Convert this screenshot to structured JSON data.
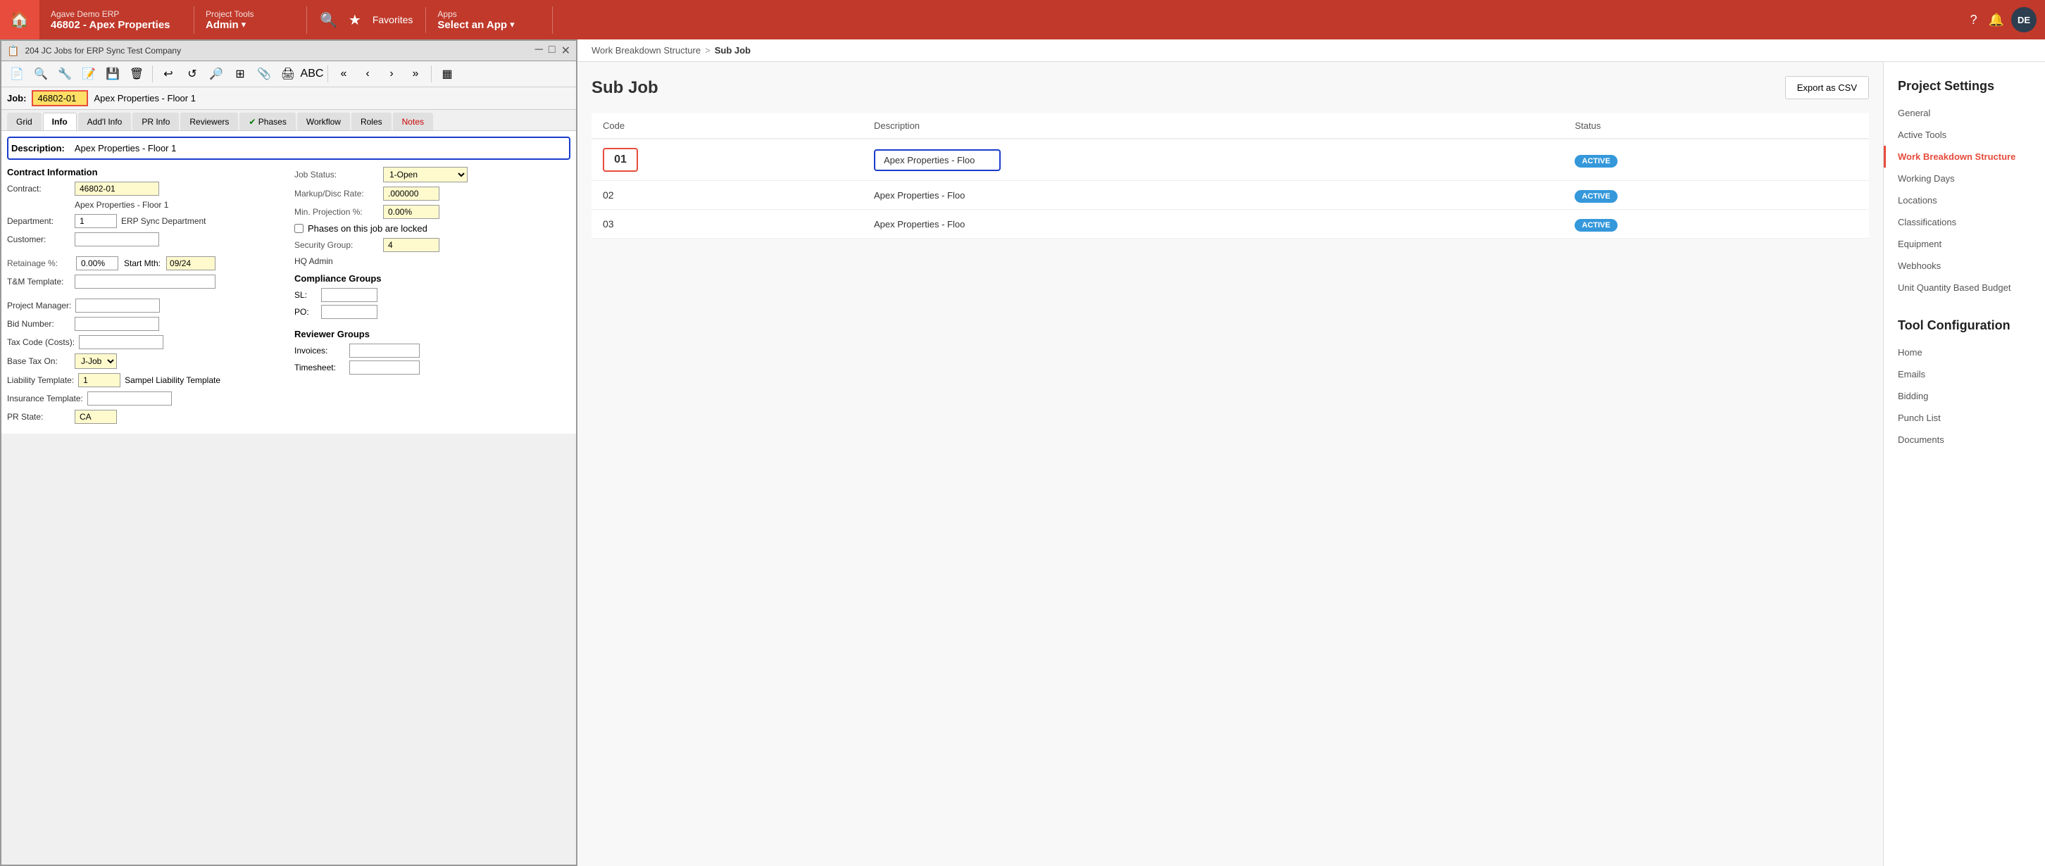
{
  "topnav": {
    "home_icon": "🏠",
    "erp_name": "Agave Demo ERP",
    "erp_project": "46802 - Apex Properties",
    "project_tools_label": "Project Tools",
    "project_tools_value": "Admin",
    "search_icon": "🔍",
    "star_icon": "★",
    "favorites_label": "Favorites",
    "apps_label": "Apps",
    "apps_value": "Select an App",
    "help_icon": "?",
    "bell_icon": "🔔",
    "avatar": "DE",
    "chevron_icon": "▾"
  },
  "window": {
    "title": "204 JC Jobs for ERP Sync Test Company",
    "job_label": "Job:",
    "job_number": "46802-01",
    "job_desc": "Apex Properties - Floor 1"
  },
  "tabs": [
    {
      "label": "Grid",
      "active": false
    },
    {
      "label": "Info",
      "active": true
    },
    {
      "label": "Add'l Info",
      "active": false
    },
    {
      "label": "PR Info",
      "active": false
    },
    {
      "label": "Reviewers",
      "active": false
    },
    {
      "label": "Phases",
      "active": false
    },
    {
      "label": "Workflow",
      "active": false
    },
    {
      "label": "Roles",
      "active": false
    },
    {
      "label": "Notes",
      "active": false,
      "red": true
    }
  ],
  "form": {
    "description_label": "Description:",
    "description_value": "Apex Properties - Floor 1",
    "contract_info_label": "Contract Information",
    "contract_label": "Contract:",
    "contract_value": "46802-01",
    "contract_name": "Apex Properties - Floor 1",
    "department_label": "Department:",
    "department_value": "1",
    "department_name": "ERP Sync Department",
    "customer_label": "Customer:",
    "customer_value": "",
    "retainage_label": "Retainage %:",
    "retainage_value": "0.00%",
    "start_mth_label": "Start Mth:",
    "start_mth_value": "09/24",
    "tm_template_label": "T&M Template:",
    "tm_template_value": "",
    "project_manager_label": "Project Manager:",
    "project_manager_value": "",
    "bid_number_label": "Bid Number:",
    "bid_number_value": "",
    "tax_code_label": "Tax Code (Costs):",
    "tax_code_value": "",
    "base_tax_label": "Base Tax On:",
    "base_tax_value": "J-Job",
    "liability_label": "Liability Template:",
    "liability_value": "1",
    "liability_name": "Sampel Liability Template",
    "insurance_label": "Insurance Template:",
    "insurance_value": "",
    "pr_state_label": "PR State:",
    "pr_state_value": "CA",
    "job_status_label": "Job Status:",
    "job_status_value": "1-Open",
    "markup_label": "Markup/Disc Rate:",
    "markup_value": ".000000",
    "min_proj_label": "Min. Projection %:",
    "min_proj_value": "0.00%",
    "phases_locked_label": "Phases on this job are locked",
    "security_group_label": "Security Group:",
    "security_group_value": "4",
    "hq_admin_label": "HQ Admin",
    "compliance_label": "Compliance Groups",
    "sl_label": "SL:",
    "sl_value": "",
    "po_label": "PO:",
    "po_value": "",
    "reviewer_label": "Reviewer Groups",
    "invoices_label": "Invoices:",
    "invoices_value": "",
    "timesheet_label": "Timesheet:",
    "timesheet_value": ""
  },
  "breadcrumb": {
    "parent": "Work Breakdown Structure",
    "separator": ">",
    "current": "Sub Job"
  },
  "subjob": {
    "title": "Sub Job",
    "export_label": "Export as CSV",
    "table_headers": [
      "Code",
      "Description",
      "Status"
    ],
    "rows": [
      {
        "code": "01",
        "description": "Apex Properties - Floo",
        "status": "ACTIVE",
        "highlight_red": true,
        "highlight_blue": true
      },
      {
        "code": "02",
        "description": "Apex Properties - Floo",
        "status": "ACTIVE",
        "highlight_red": false,
        "highlight_blue": false
      },
      {
        "code": "03",
        "description": "Apex Properties - Floo",
        "status": "ACTIVE",
        "highlight_red": false,
        "highlight_blue": false
      }
    ]
  },
  "sidebar": {
    "settings_title": "Project Settings",
    "items": [
      {
        "label": "General",
        "active": false
      },
      {
        "label": "Active Tools",
        "active": false
      },
      {
        "label": "Work Breakdown Structure",
        "active": true
      },
      {
        "label": "Working Days",
        "active": false
      },
      {
        "label": "Locations",
        "active": false
      },
      {
        "label": "Classifications",
        "active": false
      },
      {
        "label": "Equipment",
        "active": false
      },
      {
        "label": "Webhooks",
        "active": false
      },
      {
        "label": "Unit Quantity Based Budget",
        "active": false
      }
    ],
    "config_title": "Tool Configuration",
    "config_items": [
      {
        "label": "Home",
        "active": false
      },
      {
        "label": "Emails",
        "active": false
      },
      {
        "label": "Bidding",
        "active": false
      },
      {
        "label": "Punch List",
        "active": false
      },
      {
        "label": "Documents",
        "active": false
      }
    ]
  }
}
